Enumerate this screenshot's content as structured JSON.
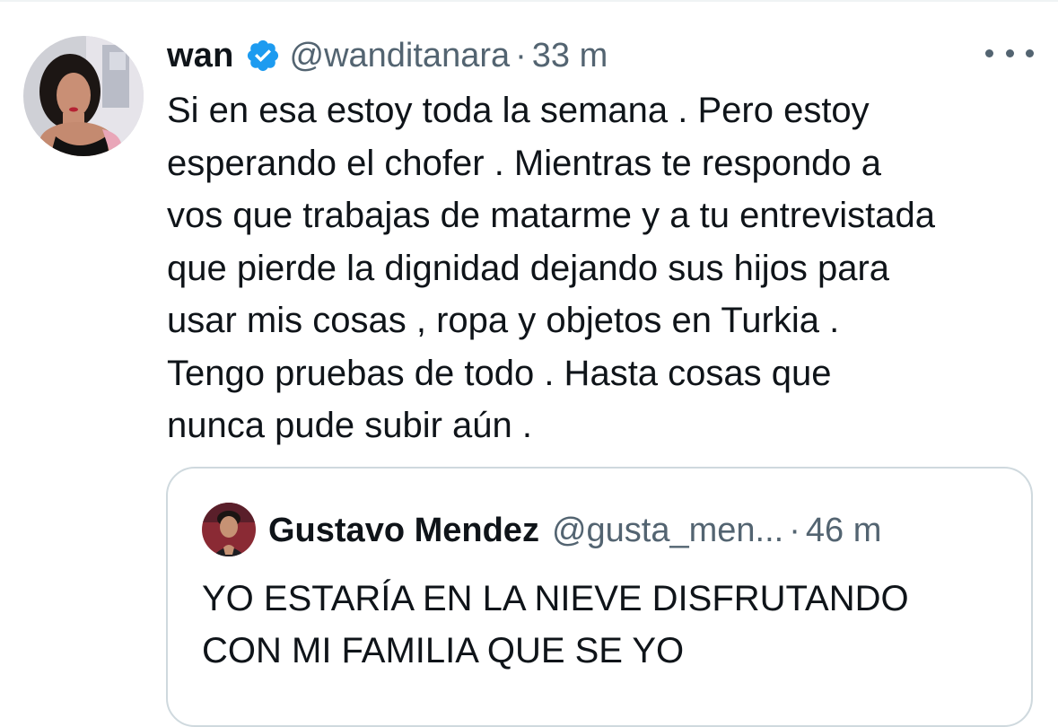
{
  "tweet": {
    "author_name": "wan",
    "author_handle": "@wanditanara",
    "separator": "·",
    "time": "33 m",
    "verified": true,
    "more_icon": "more-horizontal-icon",
    "text_lines": [
      "Si en esa estoy toda la semana . Pero estoy",
      "esperando el chofer . Mientras te respondo a",
      "vos que trabajas de matarme y a tu entrevistada",
      "que pierde la dignidad dejando sus hijos para",
      "usar mis cosas , ropa y objetos en Turkia .",
      "Tengo pruebas de todo .  Hasta cosas que",
      "nunca pude subir aún ."
    ]
  },
  "quoted_tweet": {
    "author_name": "Gustavo Mendez",
    "author_handle": "@gusta_men...",
    "separator": "·",
    "time": "46 m",
    "text_lines": [
      "YO ESTARÍA EN LA NIEVE DISFRUTANDO",
      "CON MI FAMILIA QUE SE YO"
    ]
  },
  "colors": {
    "text_primary": "#0f1419",
    "text_secondary": "#536471",
    "verified_blue": "#1d9bf0",
    "border": "#cfd9de"
  }
}
